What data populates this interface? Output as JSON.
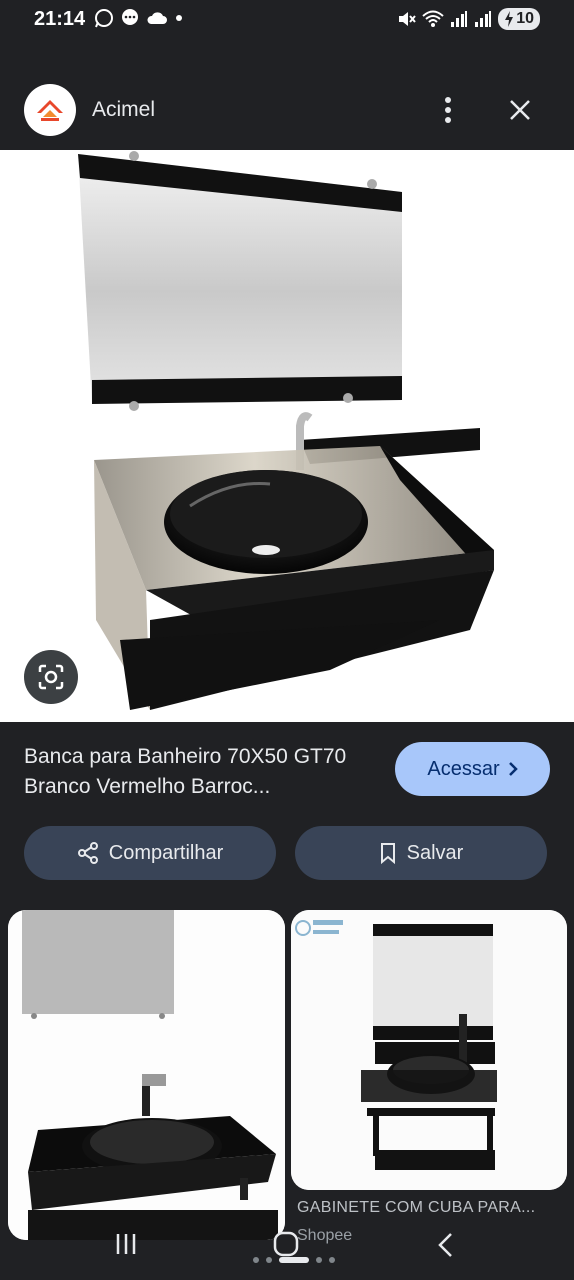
{
  "status_bar": {
    "time": "21:14",
    "battery": "10",
    "left_icons": [
      "whatsapp-icon",
      "chat-icon",
      "cloud-icon",
      "dot-icon"
    ],
    "right_icons": [
      "mute-icon",
      "wifi-icon",
      "signal-icon",
      "signal-icon",
      "battery-icon"
    ]
  },
  "header": {
    "site_name": "Acimel",
    "menu_icon": "more-vert-icon",
    "close_icon": "close-icon"
  },
  "result": {
    "title": "Banca para Banheiro 70X50 GT70 Branco Vermelho Barroc...",
    "visit_label": "Acessar",
    "share_label": "Compartilhar",
    "save_label": "Salvar",
    "lens_icon": "lens-icon"
  },
  "related": [
    {
      "title": "",
      "source": ""
    },
    {
      "title": "GABINETE COM CUBA PARA...",
      "source": "Shopee"
    }
  ],
  "colors": {
    "background": "#202124",
    "accent_button": "#a8c7fa",
    "secondary_button": "#394457"
  }
}
